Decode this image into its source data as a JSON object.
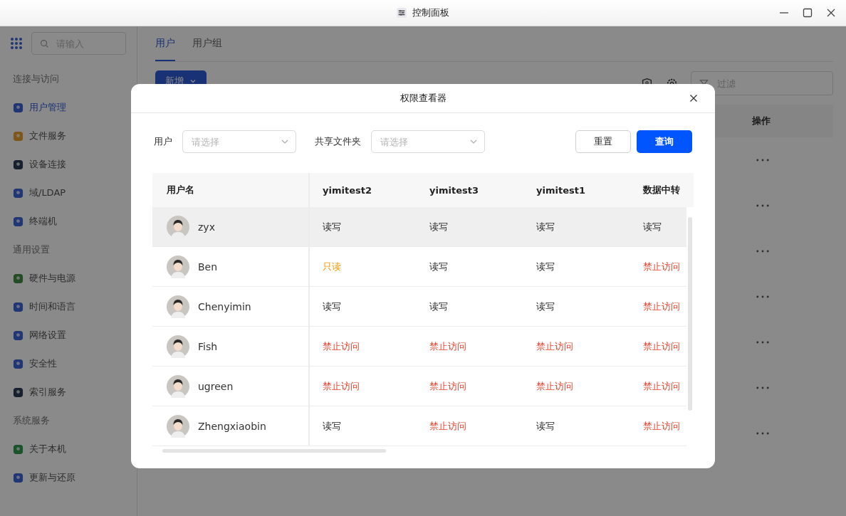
{
  "window": {
    "title": "控制面板"
  },
  "sidebar": {
    "search_placeholder": "请输入",
    "sections": [
      {
        "title": "连接与访问",
        "items": [
          {
            "label": "用户管理",
            "selected": true
          },
          {
            "label": "文件服务",
            "selected": false
          },
          {
            "label": "设备连接",
            "selected": false
          },
          {
            "label": "域/LDAP",
            "selected": false
          },
          {
            "label": "终端机",
            "selected": false
          }
        ]
      },
      {
        "title": "通用设置",
        "items": [
          {
            "label": "硬件与电源",
            "selected": false
          },
          {
            "label": "时间和语言",
            "selected": false
          },
          {
            "label": "网络设置",
            "selected": false
          },
          {
            "label": "安全性",
            "selected": false
          },
          {
            "label": "索引服务",
            "selected": false
          }
        ]
      },
      {
        "title": "系统服务",
        "items": [
          {
            "label": "关于本机",
            "selected": false
          },
          {
            "label": "更新与还原",
            "selected": false
          }
        ]
      }
    ]
  },
  "tabs": [
    {
      "label": "用户",
      "selected": true
    },
    {
      "label": "用户组",
      "selected": false
    }
  ],
  "toolbar": {
    "add_button": "新增",
    "filter_placeholder": "过滤"
  },
  "table": {
    "action_column": "操作",
    "rows": [
      {
        "has_actions": true
      },
      {
        "has_actions": true
      },
      {
        "has_actions": true
      },
      {
        "has_actions": true
      },
      {
        "has_actions": true
      },
      {
        "has_actions": true
      },
      {
        "has_actions": true
      }
    ]
  },
  "dialog": {
    "title": "权限查看器",
    "filters": [
      {
        "label": "用户",
        "placeholder": "请选择"
      },
      {
        "label": "共享文件夹",
        "placeholder": "请选择"
      }
    ],
    "buttons": [
      {
        "label": "重置",
        "kind": "secondary"
      },
      {
        "label": "查询",
        "kind": "primary"
      }
    ],
    "table": {
      "columns": [
        "用户名",
        "yimitest2",
        "yimitest3",
        "yimitest1",
        "数据中转"
      ],
      "rows": [
        {
          "selected": true,
          "cells": [
            {
              "text": "zyx",
              "kind": "user"
            },
            {
              "text": "读写",
              "kind": "rw"
            },
            {
              "text": "读写",
              "kind": "rw"
            },
            {
              "text": "读写",
              "kind": "rw"
            },
            {
              "text": "读写",
              "kind": "rw"
            }
          ]
        },
        {
          "selected": false,
          "cells": [
            {
              "text": "Ben",
              "kind": "user"
            },
            {
              "text": "只读",
              "kind": "ro"
            },
            {
              "text": "读写",
              "kind": "rw"
            },
            {
              "text": "读写",
              "kind": "rw"
            },
            {
              "text": "禁止访问",
              "kind": "deny"
            }
          ]
        },
        {
          "selected": false,
          "cells": [
            {
              "text": "Chenyimin",
              "kind": "user"
            },
            {
              "text": "读写",
              "kind": "rw"
            },
            {
              "text": "读写",
              "kind": "rw"
            },
            {
              "text": "读写",
              "kind": "rw"
            },
            {
              "text": "禁止访问",
              "kind": "deny"
            }
          ]
        },
        {
          "selected": false,
          "cells": [
            {
              "text": "Fish",
              "kind": "user"
            },
            {
              "text": "禁止访问",
              "kind": "deny"
            },
            {
              "text": "禁止访问",
              "kind": "deny"
            },
            {
              "text": "禁止访问",
              "kind": "deny"
            },
            {
              "text": "禁止访问",
              "kind": "deny"
            }
          ]
        },
        {
          "selected": false,
          "cells": [
            {
              "text": "ugreen",
              "kind": "user"
            },
            {
              "text": "禁止访问",
              "kind": "deny"
            },
            {
              "text": "禁止访问",
              "kind": "deny"
            },
            {
              "text": "禁止访问",
              "kind": "deny"
            },
            {
              "text": "禁止访问",
              "kind": "deny"
            }
          ]
        },
        {
          "selected": false,
          "cells": [
            {
              "text": "Zhengxiaobin",
              "kind": "user"
            },
            {
              "text": "读写",
              "kind": "rw"
            },
            {
              "text": "禁止访问",
              "kind": "deny"
            },
            {
              "text": "读写",
              "kind": "rw"
            },
            {
              "text": "禁止访问",
              "kind": "deny"
            }
          ]
        }
      ]
    }
  }
}
